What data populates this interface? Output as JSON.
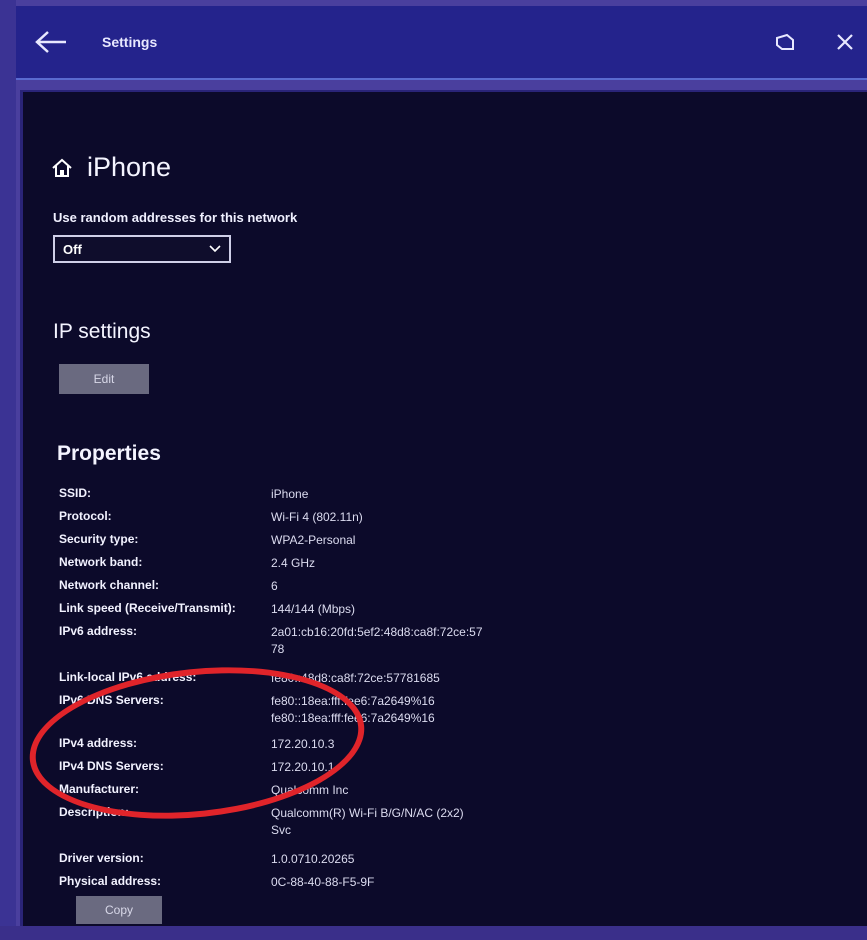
{
  "window": {
    "title": "Settings",
    "back_icon": "back-arrow-icon",
    "restore_icon": "restore-icon",
    "close_icon": "close-icon"
  },
  "page": {
    "title": "iPhone",
    "icon": "home-icon"
  },
  "random_addresses": {
    "label": "Use random addresses for this network",
    "value": "Off"
  },
  "ip_settings": {
    "heading": "IP settings",
    "edit_label": "Edit"
  },
  "properties": {
    "heading": "Properties",
    "rows": [
      {
        "key": "SSID:",
        "value": "iPhone"
      },
      {
        "key": "Protocol:",
        "value": "Wi-Fi 4 (802.11n)"
      },
      {
        "key": "Security type:",
        "value": "WPA2-Personal"
      },
      {
        "key": "Network band:",
        "value": "2.4 GHz"
      },
      {
        "key": "Network channel:",
        "value": "6"
      },
      {
        "key": "Link speed (Receive/Transmit):",
        "value": "144/144 (Mbps)"
      },
      {
        "key": "IPv6 address:",
        "value": "2a01:cb16:20fd:5ef2:48d8:ca8f:72ce:57",
        "value2": "78"
      },
      {
        "key": "Link-local IPv6 address:",
        "value": "fe80::48d8:ca8f:72ce:57781685"
      },
      {
        "key": "IPv6 DNS Servers:",
        "value": "fe80::18ea:fff:fee6:7a2649%16",
        "value2": "fe80::18ea:fff:fee6:7a2649%16"
      },
      {
        "key": "IPv4 address:",
        "value": "172.20.10.3"
      },
      {
        "key": "IPv4 DNS Servers:",
        "value": "172.20.10.1"
      },
      {
        "key": "Manufacturer:",
        "value": "Qualcomm Inc"
      },
      {
        "key": "Description:",
        "value": "Qualcomm(R) Wi-Fi B/G/N/AC (2x2)",
        "value2": "Svc"
      },
      {
        "key": "Driver version:",
        "value": "1.0.0710.20265"
      },
      {
        "key": "Physical address:",
        "value": "0C-88-40-88-F5-9F"
      }
    ],
    "copy_label": "Copy"
  },
  "annotation_color": "#e0242a"
}
